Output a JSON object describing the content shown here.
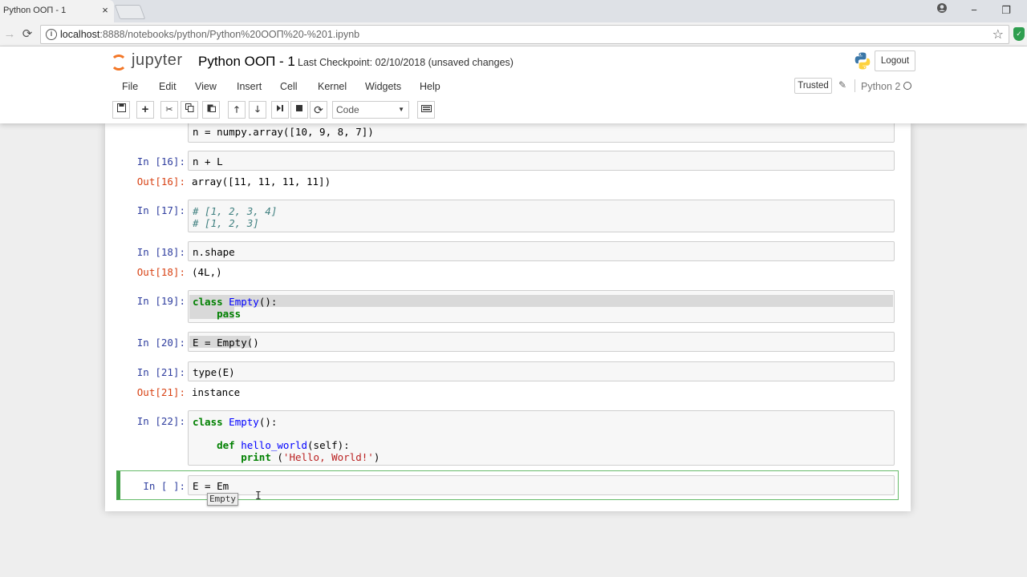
{
  "browser": {
    "tab_title": "Python ООП - 1",
    "tab_close": "×",
    "url_host": "localhost",
    "url_rest": ":8888/notebooks/python/Python%20ООП%20-%201.ipynb",
    "window_controls": {
      "minimize": "−",
      "maximize": "❐"
    }
  },
  "header": {
    "logo_text": "jupyter",
    "notebook_name": "Python ООП - 1",
    "checkpoint": "Last Checkpoint: 02/10/2018 (unsaved changes)",
    "logout_label": "Logout"
  },
  "menu": {
    "items": [
      "File",
      "Edit",
      "View",
      "Insert",
      "Cell",
      "Kernel",
      "Widgets",
      "Help"
    ],
    "trusted_label": "Trusted",
    "kernel_name": "Python 2"
  },
  "toolbar": {
    "cell_type": "Code",
    "icons": [
      "save-icon",
      "plus-icon",
      "cut-icon",
      "copy-icon",
      "paste-icon",
      "arrow-up-icon",
      "arrow-down-icon",
      "step-forward-icon",
      "stop-icon",
      "refresh-icon",
      "keyboard-icon"
    ]
  },
  "cells": {
    "c15": {
      "line2": "n = numpy.array([10, 9, 8, 7])"
    },
    "c16": {
      "in_prompt": "In [16]:",
      "code": "n + L",
      "out_prompt": "Out[16]:",
      "output": "array([11, 11, 11, 11])"
    },
    "c17": {
      "in_prompt": "In [17]:",
      "line1": "# [1, 2, 3, 4]",
      "line2": "# [1, 2, 3]"
    },
    "c18": {
      "in_prompt": "In [18]:",
      "code": "n.shape",
      "out_prompt": "Out[18]:",
      "output": "(4L,)"
    },
    "c19": {
      "in_prompt": "In [19]:",
      "kw_class": "class",
      "cls_name": "Empty",
      "tail": "():",
      "kw_pass": "pass"
    },
    "c20": {
      "in_prompt": "In [20]:",
      "code": "E = Empty()"
    },
    "c21": {
      "in_prompt": "In [21]:",
      "code": "type(E)",
      "out_prompt": "Out[21]:",
      "output": "instance"
    },
    "c22": {
      "in_prompt": "In [22]:",
      "kw_class": "class",
      "cls_name": "Empty",
      "tail": "():",
      "kw_def": "def",
      "fn_name": "hello_world",
      "fn_tail": "(self):",
      "kw_print": "print",
      "print_open": " (",
      "str": "'Hello, World!'",
      "print_close": ")"
    },
    "active": {
      "in_prompt": "In [ ]:",
      "code": "E = Em",
      "completion": "Empty"
    }
  },
  "colors": {
    "keyword": "#008000",
    "function": "#0000ff",
    "string": "#ba2121",
    "comment": "#408080",
    "in_prompt": "#303f9f",
    "out_prompt": "#d84315",
    "active_cell_border": "#43a047",
    "jupyter_orange": "#f37626"
  }
}
